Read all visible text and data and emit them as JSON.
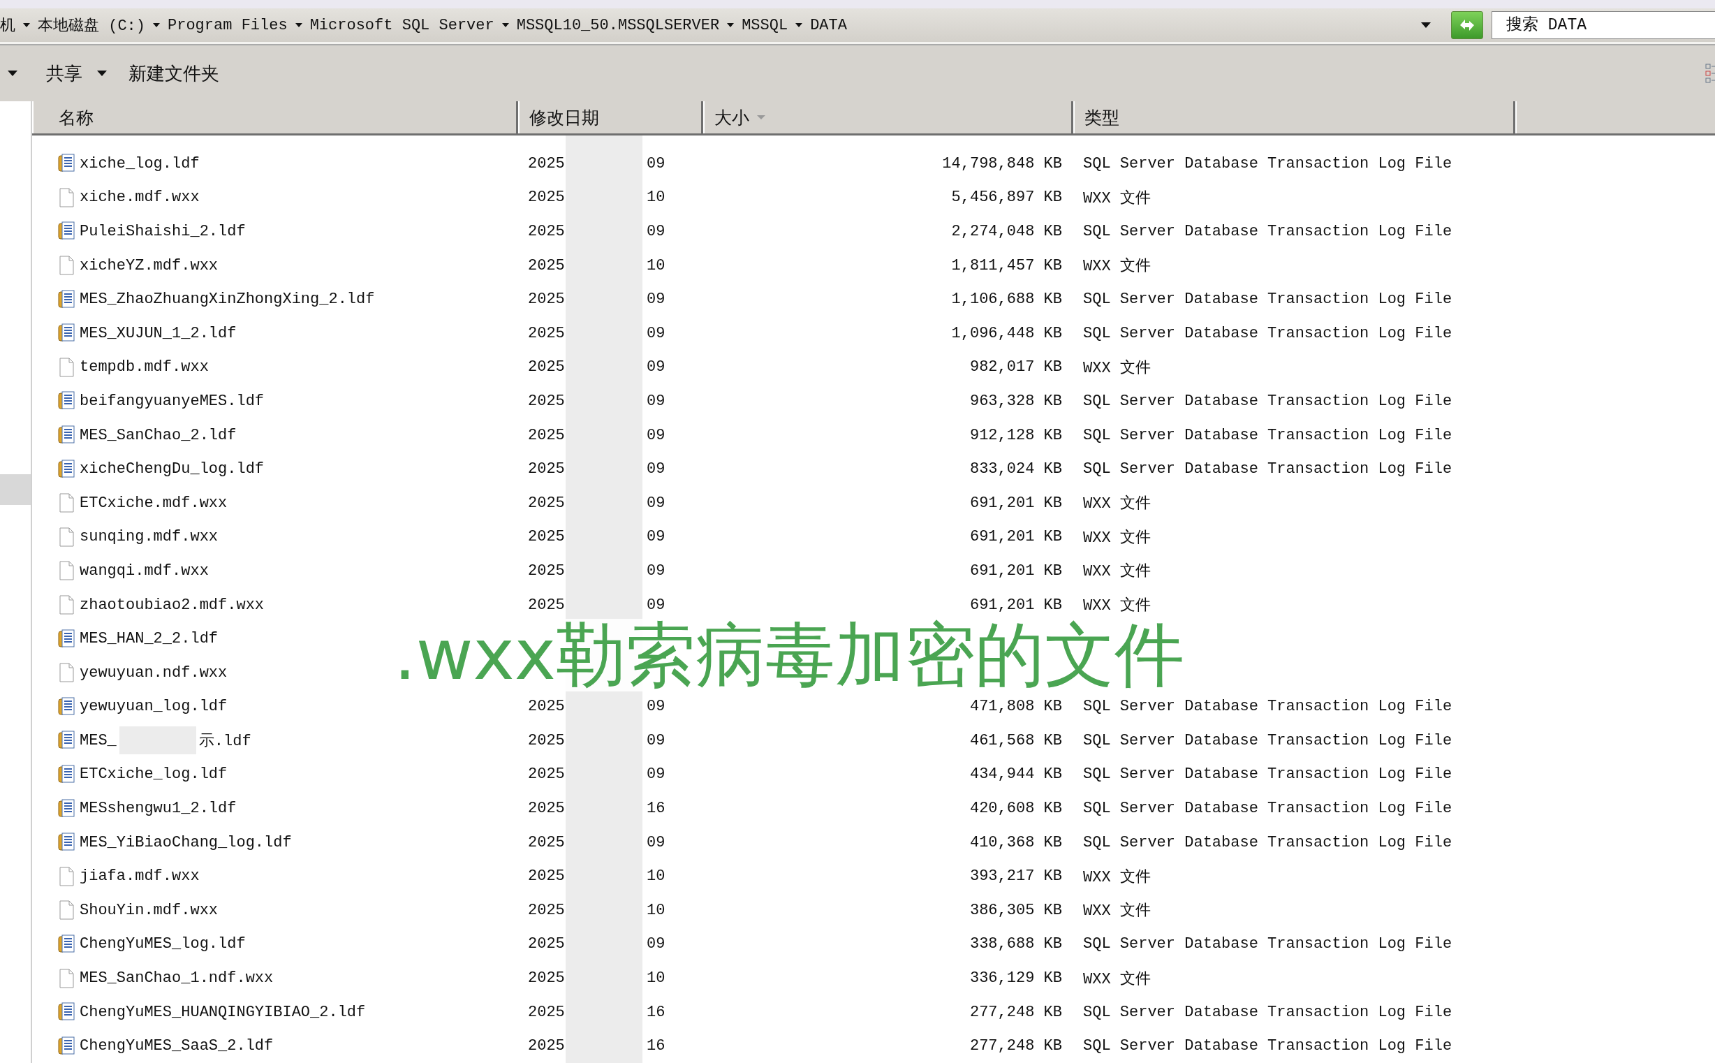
{
  "address_bar": {
    "crumbs": [
      "机",
      "本地磁盘 (C:)",
      "Program Files",
      "Microsoft SQL Server",
      "MSSQL10_50.MSSQLSERVER",
      "MSSQL",
      "DATA"
    ]
  },
  "search": {
    "placeholder": "搜索 DATA"
  },
  "toolbar": {
    "items": [
      "共享",
      "新建文件夹"
    ]
  },
  "columns": [
    {
      "label": "名称",
      "sorted": false
    },
    {
      "label": "修改日期",
      "sorted": false
    },
    {
      "label": "大小",
      "sorted": true
    },
    {
      "label": "类型",
      "sorted": false
    }
  ],
  "rows": [
    {
      "kind": "ldf",
      "name": "xiche_log.ldf",
      "modified_start": "2025",
      "modified_end": "09",
      "size": "14,798,848 KB",
      "type": "SQL Server Database Transaction Log File"
    },
    {
      "kind": "file",
      "name": "xiche.mdf.wxx",
      "modified_start": "2025",
      "modified_end": "10",
      "size": "5,456,897 KB",
      "type": "WXX 文件"
    },
    {
      "kind": "ldf",
      "name": "PuleiShaishi_2.ldf",
      "modified_start": "2025",
      "modified_end": "09",
      "size": "2,274,048 KB",
      "type": "SQL Server Database Transaction Log File"
    },
    {
      "kind": "file",
      "name": "xicheYZ.mdf.wxx",
      "modified_start": "2025",
      "modified_end": "10",
      "size": "1,811,457 KB",
      "type": "WXX 文件"
    },
    {
      "kind": "ldf",
      "name": "MES_ZhaoZhuangXinZhongXing_2.ldf",
      "modified_start": "2025",
      "modified_end": "09",
      "size": "1,106,688 KB",
      "type": "SQL Server Database Transaction Log File"
    },
    {
      "kind": "ldf",
      "name": "MES_XUJUN_1_2.ldf",
      "modified_start": "2025",
      "modified_end": "09",
      "size": "1,096,448 KB",
      "type": "SQL Server Database Transaction Log File"
    },
    {
      "kind": "file",
      "name": "tempdb.mdf.wxx",
      "modified_start": "2025",
      "modified_end": "09",
      "size": "982,017 KB",
      "type": "WXX 文件"
    },
    {
      "kind": "ldf",
      "name": "beifangyuanyeMES.ldf",
      "modified_start": "2025",
      "modified_end": "09",
      "size": "963,328 KB",
      "type": "SQL Server Database Transaction Log File"
    },
    {
      "kind": "ldf",
      "name": "MES_SanChao_2.ldf",
      "modified_start": "2025",
      "modified_end": "09",
      "size": "912,128 KB",
      "type": "SQL Server Database Transaction Log File"
    },
    {
      "kind": "ldf",
      "name": "xicheChengDu_log.ldf",
      "modified_start": "2025",
      "modified_end": "09",
      "size": "833,024 KB",
      "type": "SQL Server Database Transaction Log File"
    },
    {
      "kind": "file",
      "name": "ETCxiche.mdf.wxx",
      "modified_start": "2025",
      "modified_end": "09",
      "size": "691,201 KB",
      "type": "WXX 文件"
    },
    {
      "kind": "file",
      "name": "sunqing.mdf.wxx",
      "modified_start": "2025",
      "modified_end": "09",
      "size": "691,201 KB",
      "type": "WXX 文件"
    },
    {
      "kind": "file",
      "name": "wangqi.mdf.wxx",
      "modified_start": "2025",
      "modified_end": "09",
      "size": "691,201 KB",
      "type": "WXX 文件"
    },
    {
      "kind": "file",
      "name": "zhaotoubiao2.mdf.wxx",
      "modified_start": "2025",
      "modified_end": "09",
      "size": "691,201 KB",
      "type": "WXX 文件"
    },
    {
      "kind": "ldf",
      "name": "MES_HAN_2_2.ldf"
    },
    {
      "kind": "file",
      "name": "yewuyuan.ndf.wxx"
    },
    {
      "kind": "ldf",
      "name": "yewuyuan_log.ldf",
      "modified_start": "2025",
      "modified_end": "09",
      "size": "471,808 KB",
      "type": "SQL Server Database Transaction Log File"
    },
    {
      "kind": "ldf",
      "name": "MES_",
      "redacted": true,
      "name_tail": "示.ldf",
      "modified_start": "2025",
      "modified_end": "09",
      "size": "461,568 KB",
      "type": "SQL Server Database Transaction Log File"
    },
    {
      "kind": "ldf",
      "name": "ETCxiche_log.ldf",
      "modified_start": "2025",
      "modified_end": "09",
      "size": "434,944 KB",
      "type": "SQL Server Database Transaction Log File"
    },
    {
      "kind": "ldf",
      "name": "MESshengwu1_2.ldf",
      "modified_start": "2025",
      "modified_end": "16",
      "size": "420,608 KB",
      "type": "SQL Server Database Transaction Log File"
    },
    {
      "kind": "ldf",
      "name": "MES_YiBiaoChang_log.ldf",
      "modified_start": "2025",
      "modified_end": "09",
      "size": "410,368 KB",
      "type": "SQL Server Database Transaction Log File"
    },
    {
      "kind": "file",
      "name": "jiafa.mdf.wxx",
      "modified_start": "2025",
      "modified_end": "10",
      "size": "393,217 KB",
      "type": "WXX 文件"
    },
    {
      "kind": "file",
      "name": "ShouYin.mdf.wxx",
      "modified_start": "2025",
      "modified_end": "10",
      "size": "386,305 KB",
      "type": "WXX 文件"
    },
    {
      "kind": "ldf",
      "name": "ChengYuMES_log.ldf",
      "modified_start": "2025",
      "modified_end": "09",
      "size": "338,688 KB",
      "type": "SQL Server Database Transaction Log File"
    },
    {
      "kind": "file",
      "name": "MES_SanChao_1.ndf.wxx",
      "modified_start": "2025",
      "modified_end": "10",
      "size": "336,129 KB",
      "type": "WXX 文件"
    },
    {
      "kind": "ldf",
      "name": "ChengYuMES_HUANQINGYIBIAO_2.ldf",
      "modified_start": "2025",
      "modified_end": "16",
      "size": "277,248 KB",
      "type": "SQL Server Database Transaction Log File"
    },
    {
      "kind": "ldf",
      "name": "ChengYuMES_SaaS_2.ldf",
      "modified_start": "2025",
      "modified_end": "16",
      "size": "277,248 KB",
      "type": "SQL Server Database Transaction Log File"
    }
  ],
  "overlay_caption": ".wxx勒索病毒加密的文件"
}
